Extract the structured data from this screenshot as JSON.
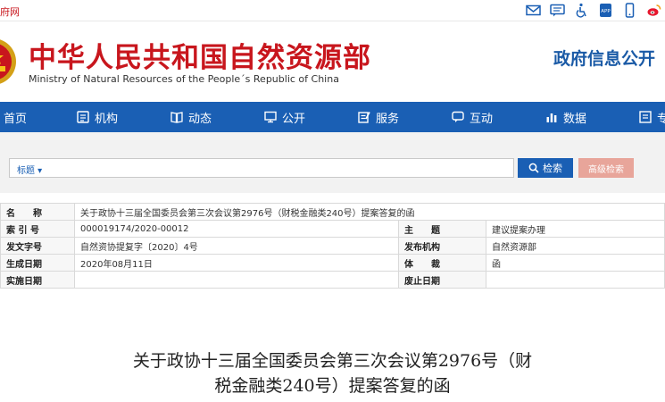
{
  "topbar": {
    "site_link": "府网",
    "tools": [
      "mail-icon",
      "message-icon",
      "accessibility-icon",
      "app-icon",
      "mobile-icon",
      "weibo-icon"
    ]
  },
  "header": {
    "title_cn": "中华人民共和国自然资源部",
    "title_en": "Ministry of Natural Resources of the People´s Republic of China",
    "right_text": "政府信息公开"
  },
  "nav": {
    "items": [
      {
        "label": "首页",
        "icon": ""
      },
      {
        "label": "机构",
        "icon": "org-icon"
      },
      {
        "label": "动态",
        "icon": "news-icon"
      },
      {
        "label": "公开",
        "icon": "screen-icon"
      },
      {
        "label": "服务",
        "icon": "service-icon"
      },
      {
        "label": "互动",
        "icon": "chat-icon"
      },
      {
        "label": "数据",
        "icon": "data-icon"
      },
      {
        "label": "专",
        "icon": "topic-icon"
      }
    ]
  },
  "search": {
    "type_label": "标题 ▾",
    "search_button": "检索",
    "advanced_button": "高级检索"
  },
  "meta": {
    "name_label": "名　　称",
    "name_value": "关于政协十三届全国委员会第三次会议第2976号（财税金融类240号）提案答复的函",
    "index_label": "索 引 号",
    "index_value": "000019174/2020-00012",
    "subject_label": "主　　题",
    "subject_value": "建议提案办理",
    "doc_no_label": "发文字号",
    "doc_no_value": "自然资协提复字〔2020〕4号",
    "issuer_label": "发布机构",
    "issuer_value": "自然资源部",
    "date_label": "生成日期",
    "date_value": "2020年08月11日",
    "genre_label": "体　　裁",
    "genre_value": "函",
    "impl_label": "实施日期",
    "impl_value": "",
    "expire_label": "废止日期",
    "expire_value": ""
  },
  "document": {
    "title_line1": "关于政协十三届全国委员会第三次会议第2976号（财",
    "title_line2": "税金融类240号）提案答复的函"
  }
}
